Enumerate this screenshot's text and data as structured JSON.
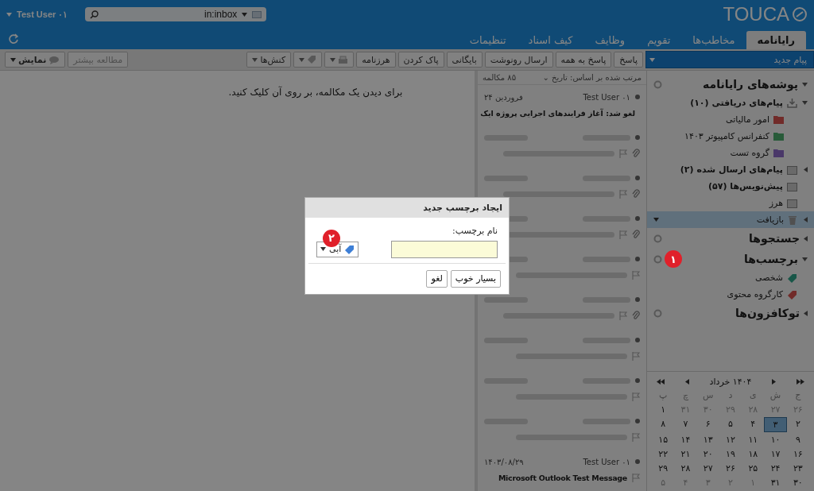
{
  "top_bar": {
    "logo": "TOUCA",
    "search": {
      "value": "in:inbox"
    },
    "user": "Test User ۰۱"
  },
  "tabs": [
    {
      "label": "رایانامه",
      "selected": true
    },
    {
      "label": "مخاطب‌ها",
      "selected": false
    },
    {
      "label": "تقویم",
      "selected": false
    },
    {
      "label": "وظایف",
      "selected": false
    },
    {
      "label": "کیف اسناد",
      "selected": false
    },
    {
      "label": "تنظیمات",
      "selected": false
    }
  ],
  "toolbar": {
    "new_message": "پیام جدید",
    "buttons": [
      {
        "kind": "text",
        "label": "پاسخ",
        "disabled": false
      },
      {
        "kind": "text",
        "label": "پاسخ به همه",
        "disabled": false
      },
      {
        "kind": "text",
        "label": "ارسال رونوشت",
        "disabled": false
      },
      {
        "kind": "text",
        "label": "بایگانی",
        "disabled": false
      },
      {
        "kind": "text",
        "label": "پاک کردن",
        "disabled": false
      },
      {
        "kind": "text",
        "label": "هرزنامه",
        "disabled": false
      },
      {
        "kind": "print",
        "disabled": true
      },
      {
        "kind": "tag",
        "disabled": true
      },
      {
        "kind": "menu",
        "label": "کنش‌ها",
        "disabled": false
      }
    ],
    "view_buttons": [
      {
        "kind": "text",
        "label": "مطالعه بیشتر",
        "disabled": true
      },
      {
        "kind": "view",
        "label": "نمایش",
        "disabled": false
      }
    ]
  },
  "sidebar": {
    "sections": [
      {
        "title": "پوشه‌های رایانامه",
        "expanded": true,
        "items": [
          {
            "kind": "inbox",
            "label": "پیام‌های دریافتی (۱۰)",
            "bold": true,
            "expanded": true,
            "selected": false,
            "children": [
              {
                "kind": "folder",
                "label": "امور مالیاتی",
                "color": "#712b29",
                "selected": false
              },
              {
                "kind": "folder",
                "label": "کنفرانس کامپیوتر ۱۴۰۳",
                "color": "#285b39",
                "selected": false
              },
              {
                "kind": "folder",
                "label": "گروه تست",
                "color": "#4a3869",
                "selected": false
              }
            ]
          },
          {
            "kind": "sent",
            "label": "پیام‌های ارسال شده (۲)",
            "bold": true,
            "expanded": false,
            "selected": false
          },
          {
            "kind": "drafts",
            "label": "پیش‌نویس‌ها (۵۷)",
            "bold": true,
            "selected": false
          },
          {
            "kind": "junk",
            "label": "هرز",
            "bold": false,
            "selected": false
          },
          {
            "kind": "trash",
            "label": "بازیافت",
            "bold": false,
            "expanded": false,
            "selected": true
          }
        ]
      },
      {
        "title": "جستجوها",
        "expanded": false
      },
      {
        "title": "برچسب‌ها",
        "expanded": true,
        "badge": "۱",
        "items": [
          {
            "kind": "tag",
            "label": "شخصی",
            "color": "#185648",
            "selected": false
          },
          {
            "kind": "tag",
            "label": "کارگروه محتوی",
            "color": "#712b29",
            "selected": false
          }
        ]
      },
      {
        "title": "توکافزون‌ها",
        "expanded": false
      }
    ]
  },
  "calendar": {
    "title": "۱۴۰۴ خرداد",
    "weekdays": [
      "ج",
      "ش",
      "ی",
      "د",
      "س",
      "چ",
      "پ"
    ],
    "days": [
      {
        "label": "۲۶",
        "other": true,
        "selected": false
      },
      {
        "label": "۲۷",
        "other": true,
        "selected": false
      },
      {
        "label": "۲۸",
        "other": true,
        "selected": false
      },
      {
        "label": "۲۹",
        "other": true,
        "selected": false
      },
      {
        "label": "۳۰",
        "other": true,
        "selected": false
      },
      {
        "label": "۳۱",
        "other": true,
        "selected": false
      },
      {
        "label": "۱",
        "other": false,
        "selected": false
      },
      {
        "label": "۲",
        "other": false,
        "selected": false
      },
      {
        "label": "۳",
        "other": false,
        "selected": true
      },
      {
        "label": "۴",
        "other": false,
        "selected": false
      },
      {
        "label": "۵",
        "other": false,
        "selected": false
      },
      {
        "label": "۶",
        "other": false,
        "selected": false
      },
      {
        "label": "۷",
        "other": false,
        "selected": false
      },
      {
        "label": "۸",
        "other": false,
        "selected": false
      },
      {
        "label": "۹",
        "other": false,
        "selected": false
      },
      {
        "label": "۱۰",
        "other": false,
        "selected": false
      },
      {
        "label": "۱۱",
        "other": false,
        "selected": false
      },
      {
        "label": "۱۲",
        "other": false,
        "selected": false
      },
      {
        "label": "۱۳",
        "other": false,
        "selected": false
      },
      {
        "label": "۱۴",
        "other": false,
        "selected": false
      },
      {
        "label": "۱۵",
        "other": false,
        "selected": false
      },
      {
        "label": "۱۶",
        "other": false,
        "selected": false
      },
      {
        "label": "۱۷",
        "other": false,
        "selected": false
      },
      {
        "label": "۱۸",
        "other": false,
        "selected": false
      },
      {
        "label": "۱۹",
        "other": false,
        "selected": false
      },
      {
        "label": "۲۰",
        "other": false,
        "selected": false
      },
      {
        "label": "۲۱",
        "other": false,
        "selected": false
      },
      {
        "label": "۲۲",
        "other": false,
        "selected": false
      },
      {
        "label": "۲۳",
        "other": false,
        "selected": false
      },
      {
        "label": "۲۴",
        "other": false,
        "selected": false
      },
      {
        "label": "۲۵",
        "other": false,
        "selected": false
      },
      {
        "label": "۲۶",
        "other": false,
        "selected": false
      },
      {
        "label": "۲۷",
        "other": false,
        "selected": false
      },
      {
        "label": "۲۸",
        "other": false,
        "selected": false
      },
      {
        "label": "۲۹",
        "other": false,
        "selected": false
      },
      {
        "label": "۳۰",
        "other": false,
        "selected": false
      },
      {
        "label": "۳۱",
        "other": false,
        "selected": false
      },
      {
        "label": "۱",
        "other": true,
        "selected": false
      },
      {
        "label": "۲",
        "other": true,
        "selected": false
      },
      {
        "label": "۳",
        "other": true,
        "selected": false
      },
      {
        "label": "۴",
        "other": true,
        "selected": false
      },
      {
        "label": "۵",
        "other": true,
        "selected": false
      }
    ]
  },
  "message_list": {
    "sort": "مرتب شده بر اساس: تاریخ ⌄",
    "count": "۸۵ مکالمه",
    "rows": [
      {
        "kind": "text",
        "sender": "Test User ۰۱",
        "date": "۲۴ فروردین",
        "subject": "لغو شد: آغاز فرایندهای اجرایی پروژه ایک",
        "attachment": false
      },
      {
        "kind": "blurred",
        "attachment": true
      },
      {
        "kind": "blurred",
        "attachment": true
      },
      {
        "kind": "blurred",
        "attachment": true
      },
      {
        "kind": "blurred",
        "attachment": false
      },
      {
        "kind": "blurred",
        "attachment": true
      },
      {
        "kind": "blurred",
        "attachment": false
      },
      {
        "kind": "blurred",
        "attachment": false
      },
      {
        "kind": "blurred",
        "attachment": false
      },
      {
        "kind": "text",
        "sender": "Test User ۰۱",
        "date": "۱۴۰۳/۰۸/۲۹",
        "subject": "Microsoft Outlook Test Message",
        "attachment": false
      }
    ]
  },
  "reading_pane": {
    "hint": "برای دیدن یک مکالمه، بر روی آن کلیک کنید."
  },
  "dialog": {
    "title": "ایجاد برچسب جدید",
    "name_label": "نام برچسب:",
    "color_label": "آبی",
    "badge": "۲",
    "buttons": [
      "بسیار خوب",
      "لغو"
    ]
  }
}
